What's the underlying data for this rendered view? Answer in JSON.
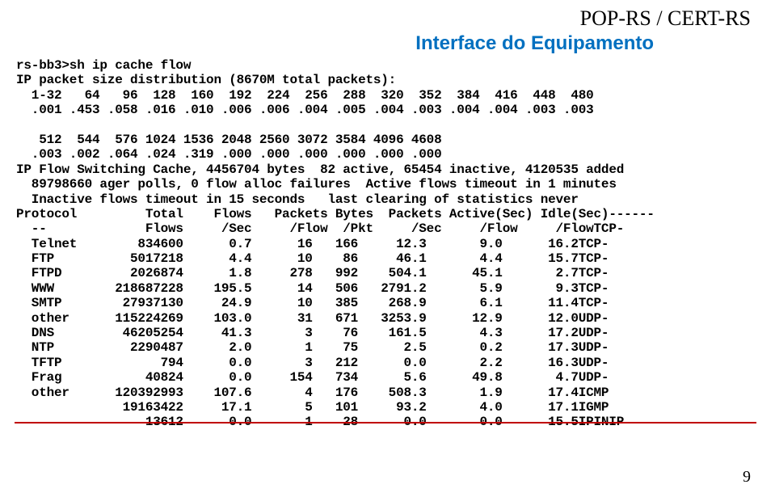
{
  "header": {
    "title": "POP-RS / CERT-RS",
    "subtitle": "Interface do Equipamento"
  },
  "page_number": "9",
  "terminal": {
    "prompt": "rs-bb3>sh ip cache flow",
    "dist_line": "IP packet size distribution (8670M total packets):",
    "dist_row1_labels": "  1-32   64   96  128  160  192  224  256  288  320  352  384  416  448  480",
    "dist_row1_values": "  .001 .453 .058 .016 .010 .006 .006 .004 .005 .004 .003 .004 .004 .003 .003",
    "dist_row2_labels": "   512  544  576 1024 1536 2048 2560 3072 3584 4096 4608",
    "dist_row2_values": "  .003 .002 .064 .024 .319 .000 .000 .000 .000 .000 .000",
    "cache_line1": "IP Flow Switching Cache, 4456704 bytes  82 active, 65454 inactive, 4120535 added",
    "cache_line2": "  89798660 ager polls, 0 flow alloc failures  Active flows timeout in 1 minutes",
    "cache_line3": "  Inactive flows timeout in 15 seconds   last clearing of statistics never",
    "table_header1": "Protocol         Total    Flows   Packets Bytes  Packets Active(Sec) Idle(Sec)------",
    "table_header2": "  --             Flows     /Sec     /Flow  /Pkt     /Sec     /Flow     /FlowTCP-",
    "rows": [
      "  Telnet        834600      0.7      16   166     12.3       9.0      16.2TCP-",
      "  FTP          5017218      4.4      10    86     46.1       4.4      15.7TCP-",
      "  FTPD         2026874      1.8     278   992    504.1      45.1       2.7TCP-",
      "  WWW        218687228    195.5      14   506   2791.2       5.9       9.3TCP-",
      "  SMTP        27937130     24.9      10   385    268.9       6.1      11.4TCP-",
      "  other      115224269    103.0      31   671   3253.9      12.9      12.0UDP-",
      "  DNS         46205254     41.3       3    76    161.5       4.3      17.2UDP-",
      "  NTP          2290487      2.0       1    75      2.5       0.2      17.3UDP-",
      "  TFTP             794      0.0       3   212      0.0       2.2      16.3UDP-",
      "  Frag           40824      0.0     154   734      5.6      49.8       4.7UDP-",
      "  other      120392993    107.6       4   176    508.3       1.9      17.4ICMP",
      "              19163422     17.1       5   101     93.2       4.0      17.1IGMP",
      "                 13612      0.0       1    28      0.0       0.0      15.5IPINIP"
    ]
  }
}
